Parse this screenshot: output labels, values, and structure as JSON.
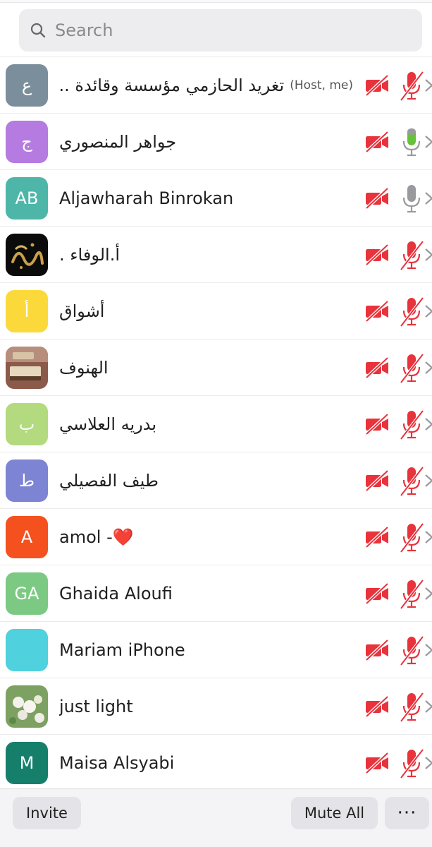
{
  "search": {
    "placeholder": "Search"
  },
  "participants": [
    {
      "name": "تغريد الحازمي مؤسسة وقائدة ...",
      "tag": "(Host, me)",
      "avatar_letter": "ع",
      "avatar_color": "#7b8e9b",
      "video": "off",
      "mic": "muted"
    },
    {
      "name": "جواهر المنصوري",
      "avatar_letter": "ج",
      "avatar_color": "#b57be0",
      "video": "off",
      "mic": "active"
    },
    {
      "name": "Aljawharah Binrokan",
      "avatar_letter": "AB",
      "avatar_color": "#4db6a8",
      "video": "off",
      "mic": "unmuted"
    },
    {
      "name": "أ.الوفاء .",
      "avatar_image": "calligraphy",
      "video": "off",
      "mic": "muted"
    },
    {
      "name": "أشواق",
      "avatar_letter": "أ",
      "avatar_color": "#fbd93b",
      "video": "off",
      "mic": "muted"
    },
    {
      "name": "الهنوف",
      "avatar_image": "quran-photo",
      "video": "off",
      "mic": "muted"
    },
    {
      "name": "بدريه العلاسي",
      "avatar_letter": "ب",
      "avatar_color": "#b3da7e",
      "video": "off",
      "mic": "muted"
    },
    {
      "name": "طيف الفصيلي",
      "avatar_letter": "ط",
      "avatar_color": "#7d84d4",
      "video": "off",
      "mic": "muted"
    },
    {
      "name": "amol -",
      "name_suffix": "❤️",
      "avatar_letter": "A",
      "avatar_color": "#f4511e",
      "video": "off",
      "mic": "muted"
    },
    {
      "name": "Ghaida Aloufi",
      "avatar_letter": "GA",
      "avatar_color": "#7bc982",
      "video": "off",
      "mic": "muted"
    },
    {
      "name": "Mariam iPhone",
      "avatar_letter": "",
      "avatar_color": "#4fd1de",
      "video": "off",
      "mic": "muted"
    },
    {
      "name": "just light",
      "avatar_image": "flowers-photo",
      "video": "off",
      "mic": "muted"
    },
    {
      "name": "Maisa Alsyabi",
      "avatar_letter": "M",
      "avatar_color": "#157f6c",
      "video": "off",
      "mic": "muted"
    }
  ],
  "footer": {
    "invite_label": "Invite",
    "mute_all_label": "Mute All",
    "more_label": "···"
  },
  "colors": {
    "muted_red": "#e8333c",
    "active_green": "#66c23a",
    "unmuted_gray": "#9a9a9e"
  }
}
